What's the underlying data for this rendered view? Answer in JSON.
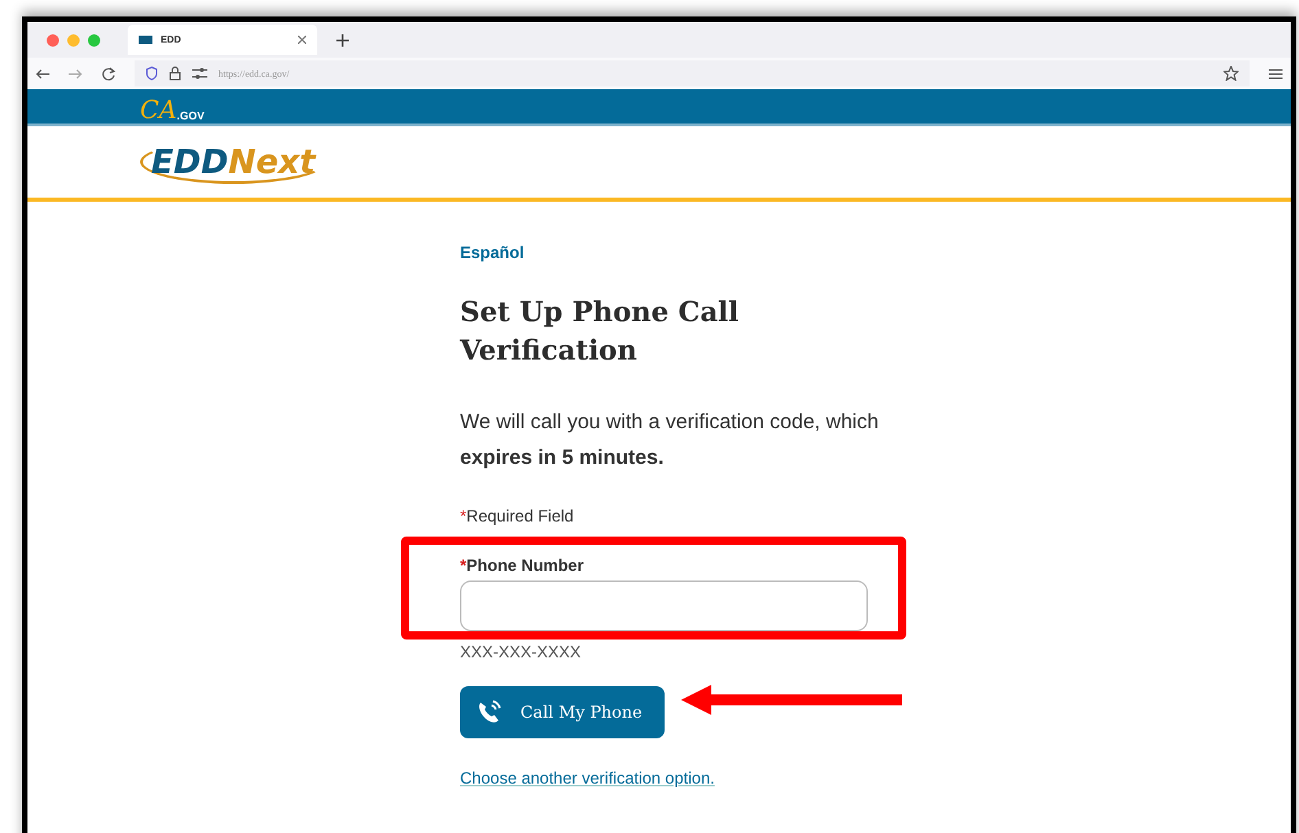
{
  "browser": {
    "tab": {
      "title": "EDD",
      "selected": true
    },
    "url": "https://edd.ca.gov/"
  },
  "header": {
    "ca_logo": {
      "mark": "CA",
      "suffix": ".GOV"
    },
    "edd_logo": {
      "first": "EDD",
      "second": "Next"
    }
  },
  "form": {
    "language_link": "Español",
    "title": "Set Up Phone Call Verification",
    "intro": "We will call you with a verification code, which **expires in 5 minutes.**",
    "required_note": {
      "asterisk": "*",
      "text": "Required Field"
    },
    "phone_field": {
      "asterisk": "*",
      "label": "Phone Number",
      "hint": "XXX-XXX-XXXX"
    },
    "call_button": "Call My Phone",
    "other_option_link": "Choose another verification option."
  }
}
